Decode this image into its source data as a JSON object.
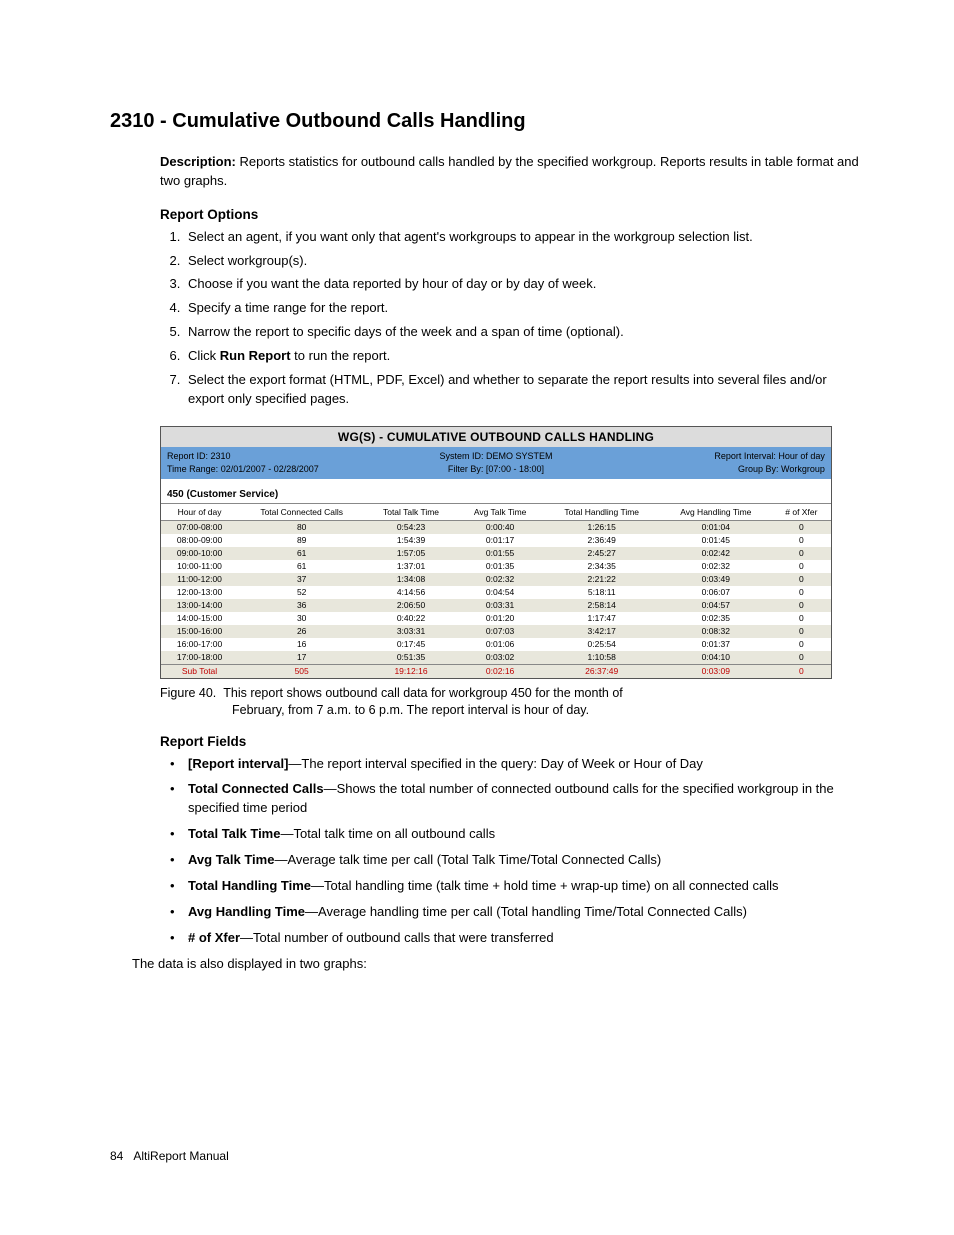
{
  "heading": "2310 - Cumulative Outbound Calls Handling",
  "description_label": "Description:",
  "description_text": " Reports statistics for outbound calls handled by the specified workgroup. Reports results in table format and two graphs.",
  "sections": {
    "report_options_heading": "Report Options",
    "report_fields_heading": "Report Fields"
  },
  "steps": {
    "s1": "Select an agent, if you want only that agent's workgroups to appear in the workgroup selection list.",
    "s2": "Select workgroup(s).",
    "s3": "Choose if you want the data reported by hour of day or by day of week.",
    "s4": "Specify a time range for the report.",
    "s5": "Narrow the report to specific days of the week and a span of time (optional).",
    "s6a": "Click ",
    "s6b": "Run Report",
    "s6c": " to run the report.",
    "s7": "Select the export format (HTML, PDF, Excel) and whether to separate the report results into several files and/or export only specified pages."
  },
  "report": {
    "title": "WG(S) - CUMULATIVE OUTBOUND CALLS HANDLING",
    "meta": {
      "report_id": "Report ID: 2310",
      "system_id": "System ID: DEMO SYSTEM",
      "interval": "Report Interval: Hour of day",
      "time_range": "Time Range: 02/01/2007 - 02/28/2007",
      "filter_by": "Filter By: [07:00 - 18:00]",
      "group_by": "Group By: Workgroup"
    },
    "workgroup_label": "450 (Customer Service)",
    "columns": {
      "c0": "Hour of day",
      "c1": "Total Connected Calls",
      "c2": "Total Talk Time",
      "c3": "Avg Talk Time",
      "c4": "Total Handling Time",
      "c5": "Avg Handling Time",
      "c6": "# of Xfer"
    },
    "rows": [
      {
        "c0": "07:00-08:00",
        "c1": "80",
        "c2": "0:54:23",
        "c3": "0:00:40",
        "c4": "1:26:15",
        "c5": "0:01:04",
        "c6": "0"
      },
      {
        "c0": "08:00-09:00",
        "c1": "89",
        "c2": "1:54:39",
        "c3": "0:01:17",
        "c4": "2:36:49",
        "c5": "0:01:45",
        "c6": "0"
      },
      {
        "c0": "09:00-10:00",
        "c1": "61",
        "c2": "1:57:05",
        "c3": "0:01:55",
        "c4": "2:45:27",
        "c5": "0:02:42",
        "c6": "0"
      },
      {
        "c0": "10:00-11:00",
        "c1": "61",
        "c2": "1:37:01",
        "c3": "0:01:35",
        "c4": "2:34:35",
        "c5": "0:02:32",
        "c6": "0"
      },
      {
        "c0": "11:00-12:00",
        "c1": "37",
        "c2": "1:34:08",
        "c3": "0:02:32",
        "c4": "2:21:22",
        "c5": "0:03:49",
        "c6": "0"
      },
      {
        "c0": "12:00-13:00",
        "c1": "52",
        "c2": "4:14:56",
        "c3": "0:04:54",
        "c4": "5:18:11",
        "c5": "0:06:07",
        "c6": "0"
      },
      {
        "c0": "13:00-14:00",
        "c1": "36",
        "c2": "2:06:50",
        "c3": "0:03:31",
        "c4": "2:58:14",
        "c5": "0:04:57",
        "c6": "0"
      },
      {
        "c0": "14:00-15:00",
        "c1": "30",
        "c2": "0:40:22",
        "c3": "0:01:20",
        "c4": "1:17:47",
        "c5": "0:02:35",
        "c6": "0"
      },
      {
        "c0": "15:00-16:00",
        "c1": "26",
        "c2": "3:03:31",
        "c3": "0:07:03",
        "c4": "3:42:17",
        "c5": "0:08:32",
        "c6": "0"
      },
      {
        "c0": "16:00-17:00",
        "c1": "16",
        "c2": "0:17:45",
        "c3": "0:01:06",
        "c4": "0:25:54",
        "c5": "0:01:37",
        "c6": "0"
      },
      {
        "c0": "17:00-18:00",
        "c1": "17",
        "c2": "0:51:35",
        "c3": "0:03:02",
        "c4": "1:10:58",
        "c5": "0:04:10",
        "c6": "0"
      }
    ],
    "subtotal": {
      "c0": "Sub Total",
      "c1": "505",
      "c2": "19:12:16",
      "c3": "0:02:16",
      "c4": "26:37:49",
      "c5": "0:03:09",
      "c6": "0"
    }
  },
  "figure": {
    "label": "Figure 40.",
    "line1": "This report shows outbound call data for workgroup 450 for the month of",
    "line2": "February, from 7 a.m. to 6 p.m. The report interval is hour of day."
  },
  "fields": {
    "f1_b": "[Report interval]",
    "f1_t": "—The report interval specified in the query: Day of Week or Hour of Day",
    "f2_b": "Total Connected Calls",
    "f2_t": "—Shows the total number of connected outbound calls for the specified workgroup in the specified time period",
    "f3_b": "Total Talk Time",
    "f3_t": "—Total talk time on all outbound calls",
    "f4_b": "Avg Talk Time",
    "f4_t": "—Average talk time per call (Total Talk Time/Total Connected Calls)",
    "f5_b": "Total Handling Time",
    "f5_t": "—Total handling time (talk time + hold time + wrap-up time) on all connected calls",
    "f6_b": "Avg Handling Time",
    "f6_t": "—Average handling time per call (Total handling Time/Total Connected Calls)",
    "f7_b": "# of Xfer",
    "f7_t": "—Total number of outbound calls that were transferred"
  },
  "closing_text": "The data is also displayed in two graphs:",
  "footer": {
    "page_no": "84",
    "doc_title": "AltiReport Manual"
  }
}
